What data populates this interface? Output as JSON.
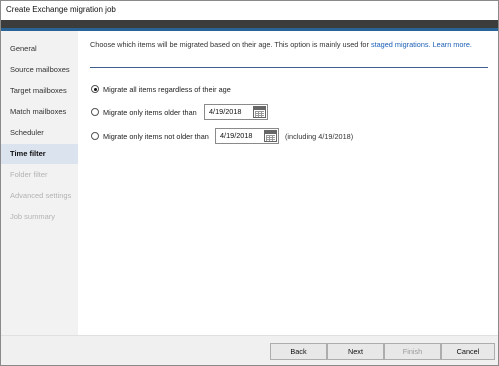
{
  "window": {
    "title": "Create Exchange migration job"
  },
  "sidebar": {
    "items": [
      {
        "label": "General"
      },
      {
        "label": "Source mailboxes"
      },
      {
        "label": "Target mailboxes"
      },
      {
        "label": "Match mailboxes"
      },
      {
        "label": "Scheduler"
      },
      {
        "label": "Time filter"
      },
      {
        "label": "Folder filter"
      },
      {
        "label": "Advanced settings"
      },
      {
        "label": "Job summary"
      }
    ],
    "active": "Time filter"
  },
  "main": {
    "description": "Choose which items will be migrated based on their age. This option is mainly used for",
    "description_link": "staged migrations.",
    "learn_more": "Learn more.",
    "options": [
      {
        "label": "Migrate all items regardless of their age",
        "checked": true
      },
      {
        "label": "Migrate only items older than",
        "date": "4/19/2018",
        "checked": false
      },
      {
        "label": "Migrate only items not older than",
        "date": "4/19/2018",
        "note": "(including 4/19/2018)",
        "checked": false
      }
    ]
  },
  "footer": {
    "back": "Back",
    "next": "Next",
    "finish": "Finish",
    "cancel": "Cancel"
  }
}
